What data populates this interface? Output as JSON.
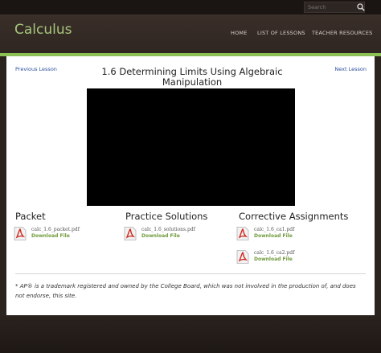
{
  "search": {
    "placeholder": "Search"
  },
  "header": {
    "site_title": "Calculus"
  },
  "nav": {
    "home": "HOME",
    "lessons": "LIST OF LESSONS",
    "teacher": "TEACHER RESOURCES"
  },
  "lesson": {
    "prev": "Previous Lesson",
    "next": "Next Lesson",
    "title": "1.6 Determining Limits Using Algebraic Manipulation"
  },
  "sections": {
    "packet": "Packet",
    "practice": "Practice Solutions",
    "corrective": "Corrective Assignments"
  },
  "files": [
    {
      "name": "calc_1.6_packet.pdf",
      "action": "Download File"
    },
    {
      "name": "calc_1.6_solutions.pdf",
      "action": "Download File"
    },
    {
      "name": "calc_1.6_ca1.pdf",
      "action": "Download File"
    },
    {
      "name": "calc_1.6_ca2.pdf",
      "action": "Download File"
    }
  ],
  "footnote": "* AP® is a trademark registered and owned by the College Board, which was not involved in the production of, and does not endorse, this site.",
  "colors": {
    "accent_green": "#8cbf54",
    "title_green": "#a7c77d",
    "link_blue": "#2a4f9c"
  }
}
